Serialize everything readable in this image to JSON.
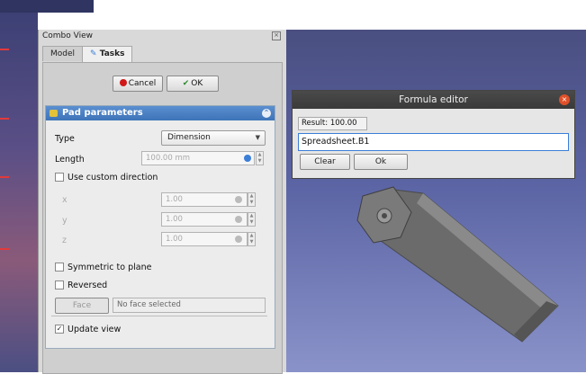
{
  "combo_view": {
    "title": "Combo View",
    "tabs": [
      {
        "label": "Model"
      },
      {
        "label": "Tasks"
      }
    ]
  },
  "actions": {
    "cancel_label": "Cancel",
    "ok_label": "OK"
  },
  "pad": {
    "title": "Pad parameters",
    "type_label": "Type",
    "type_value": "Dimension",
    "length_label": "Length",
    "length_value": "100.00 mm",
    "use_custom_direction": "Use custom direction",
    "x_label": "x",
    "y_label": "y",
    "z_label": "z",
    "x_value": "1.00",
    "y_value": "1.00",
    "z_value": "1.00",
    "symmetric_label": "Symmetric to plane",
    "reversed_label": "Reversed",
    "face_button": "Face",
    "face_value": "No face selected",
    "update_view_label": "Update view",
    "update_view_checked": true
  },
  "formula_editor": {
    "title": "Formula editor",
    "result": "Result: 100.00",
    "expression": "Spreadsheet.B1",
    "clear_label": "Clear",
    "ok_label": "Ok"
  },
  "colors": {
    "accent": "#3e74b8",
    "close_red": "#e0512a",
    "cancel_red": "#d01818"
  }
}
